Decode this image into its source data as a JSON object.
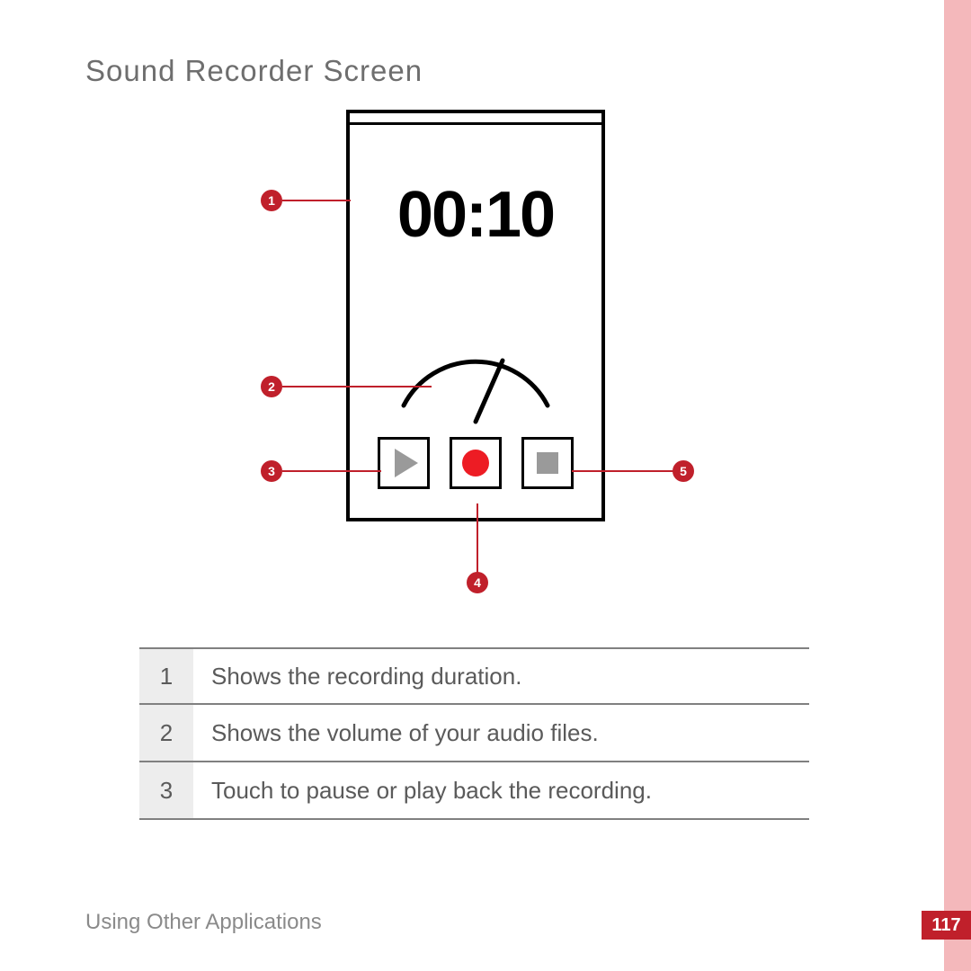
{
  "heading": "Sound Recorder Screen",
  "device": {
    "timer": "00:10",
    "controls": {
      "play_icon_name": "play-icon",
      "record_icon_name": "record-icon",
      "stop_icon_name": "stop-icon"
    }
  },
  "callouts": {
    "c1": "1",
    "c2": "2",
    "c3": "3",
    "c4": "4",
    "c5": "5"
  },
  "legend": [
    {
      "num": "1",
      "desc": "Shows the recording duration."
    },
    {
      "num": "2",
      "desc": "Shows the volume of your audio files."
    },
    {
      "num": "3",
      "desc": "Touch to pause or play back the recording."
    }
  ],
  "footer_section": "Using Other Applications",
  "page_number": "117",
  "colors": {
    "accent": "#c0202b",
    "edge": "#f4b8bb",
    "record": "#ed1c24"
  }
}
